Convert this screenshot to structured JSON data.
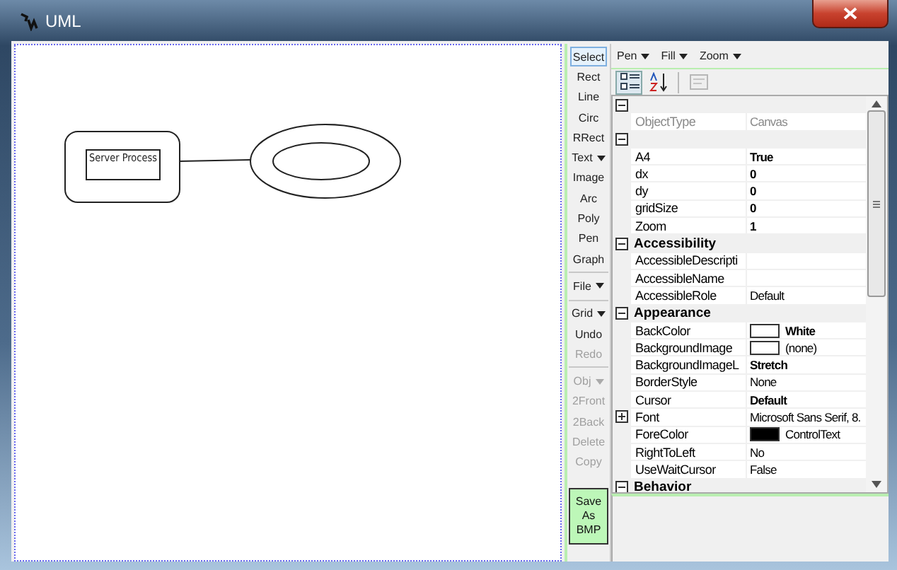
{
  "window": {
    "title": "UML"
  },
  "diagram": {
    "label": "Server Process"
  },
  "tool_groups": [
    {
      "items": [
        {
          "label": "Select",
          "selected": true,
          "disabled": false,
          "dropdown": false
        },
        {
          "label": "Rect",
          "selected": false,
          "disabled": false,
          "dropdown": false
        },
        {
          "label": "Line",
          "selected": false,
          "disabled": false,
          "dropdown": false
        },
        {
          "label": "Circ",
          "selected": false,
          "disabled": false,
          "dropdown": false
        },
        {
          "label": "RRect",
          "selected": false,
          "disabled": false,
          "dropdown": false
        },
        {
          "label": "Text",
          "selected": false,
          "disabled": false,
          "dropdown": true
        },
        {
          "label": "Image",
          "selected": false,
          "disabled": false,
          "dropdown": false
        },
        {
          "label": "Arc",
          "selected": false,
          "disabled": false,
          "dropdown": false
        },
        {
          "label": "Poly",
          "selected": false,
          "disabled": false,
          "dropdown": false
        },
        {
          "label": "Pen",
          "selected": false,
          "disabled": false,
          "dropdown": false
        },
        {
          "label": "Graph",
          "selected": false,
          "disabled": false,
          "dropdown": false
        }
      ]
    },
    {
      "items": [
        {
          "label": "File",
          "selected": false,
          "disabled": false,
          "dropdown": true
        }
      ]
    },
    {
      "items": [
        {
          "label": "Grid",
          "selected": false,
          "disabled": false,
          "dropdown": true
        },
        {
          "label": "Undo",
          "selected": false,
          "disabled": false,
          "dropdown": false
        },
        {
          "label": "Redo",
          "selected": false,
          "disabled": true,
          "dropdown": false
        }
      ]
    },
    {
      "items": [
        {
          "label": "Obj",
          "selected": false,
          "disabled": true,
          "dropdown": true
        },
        {
          "label": "2Front",
          "selected": false,
          "disabled": true,
          "dropdown": false
        },
        {
          "label": "2Back",
          "selected": false,
          "disabled": true,
          "dropdown": false
        },
        {
          "label": "Delete",
          "selected": false,
          "disabled": true,
          "dropdown": false
        },
        {
          "label": "Copy",
          "selected": false,
          "disabled": true,
          "dropdown": false
        }
      ]
    }
  ],
  "save_button": {
    "label": "Save As BMP"
  },
  "menu": [
    {
      "label": "Pen",
      "dropdown": true
    },
    {
      "label": "Fill",
      "dropdown": true
    },
    {
      "label": "Zoom",
      "dropdown": true
    }
  ],
  "grid_toolbar": [
    {
      "kind": "categorized",
      "selected": true,
      "disabled": false
    },
    {
      "kind": "alphabetical",
      "selected": false,
      "disabled": false
    },
    {
      "kind": "property-pages",
      "selected": false,
      "disabled": true
    }
  ],
  "categories": [
    {
      "expanded": true,
      "rows": [
        {
          "name": "ObjectType",
          "value": "Canvas",
          "bold": false,
          "readonly": true,
          "expandable": false
        }
      ]
    },
    {
      "expanded": true,
      "rows": [
        {
          "name": "A4",
          "value": "True",
          "bold": true,
          "readonly": false,
          "expandable": false
        },
        {
          "name": "dx",
          "value": "0",
          "bold": true,
          "readonly": false,
          "expandable": false
        },
        {
          "name": "dy",
          "value": "0",
          "bold": true,
          "readonly": false,
          "expandable": false
        },
        {
          "name": "gridSize",
          "value": "0",
          "bold": true,
          "readonly": false,
          "expandable": false
        },
        {
          "name": "Zoom",
          "value": "1",
          "bold": true,
          "readonly": false,
          "expandable": false
        }
      ]
    },
    {
      "name": "Accessibility",
      "expanded": true,
      "rows": [
        {
          "name": "AccessibleDescripti",
          "readonly": false,
          "expandable": false
        },
        {
          "name": "AccessibleName",
          "readonly": false,
          "expandable": false
        },
        {
          "name": "AccessibleRole",
          "value": "Default",
          "bold": false,
          "readonly": false,
          "expandable": false
        }
      ]
    },
    {
      "name": "Appearance",
      "expanded": true,
      "rows": [
        {
          "name": "BackColor",
          "value": "White",
          "bold": true,
          "readonly": false,
          "expandable": false,
          "color": "#ffffff"
        },
        {
          "name": "BackgroundImage",
          "value": "(none)",
          "bold": false,
          "readonly": false,
          "expandable": false,
          "color": "#ffffff"
        },
        {
          "name": "BackgroundImageL",
          "value": "Stretch",
          "bold": true,
          "readonly": false,
          "expandable": false
        },
        {
          "name": "BorderStyle",
          "value": "None",
          "bold": false,
          "readonly": false,
          "expandable": false
        },
        {
          "name": "Cursor",
          "value": "Default",
          "bold": true,
          "readonly": false,
          "expandable": false
        },
        {
          "name": "Font",
          "value": "Microsoft Sans Serif, 8.",
          "bold": false,
          "readonly": false,
          "expandable": true
        },
        {
          "name": "ForeColor",
          "value": "ControlText",
          "bold": false,
          "readonly": false,
          "expandable": false,
          "color": "#000000"
        },
        {
          "name": "RightToLeft",
          "value": "No",
          "bold": false,
          "readonly": false,
          "expandable": false
        },
        {
          "name": "UseWaitCursor",
          "value": "False",
          "bold": false,
          "readonly": false,
          "expandable": false
        }
      ]
    },
    {
      "name": "Behavior",
      "expanded": true
    }
  ]
}
